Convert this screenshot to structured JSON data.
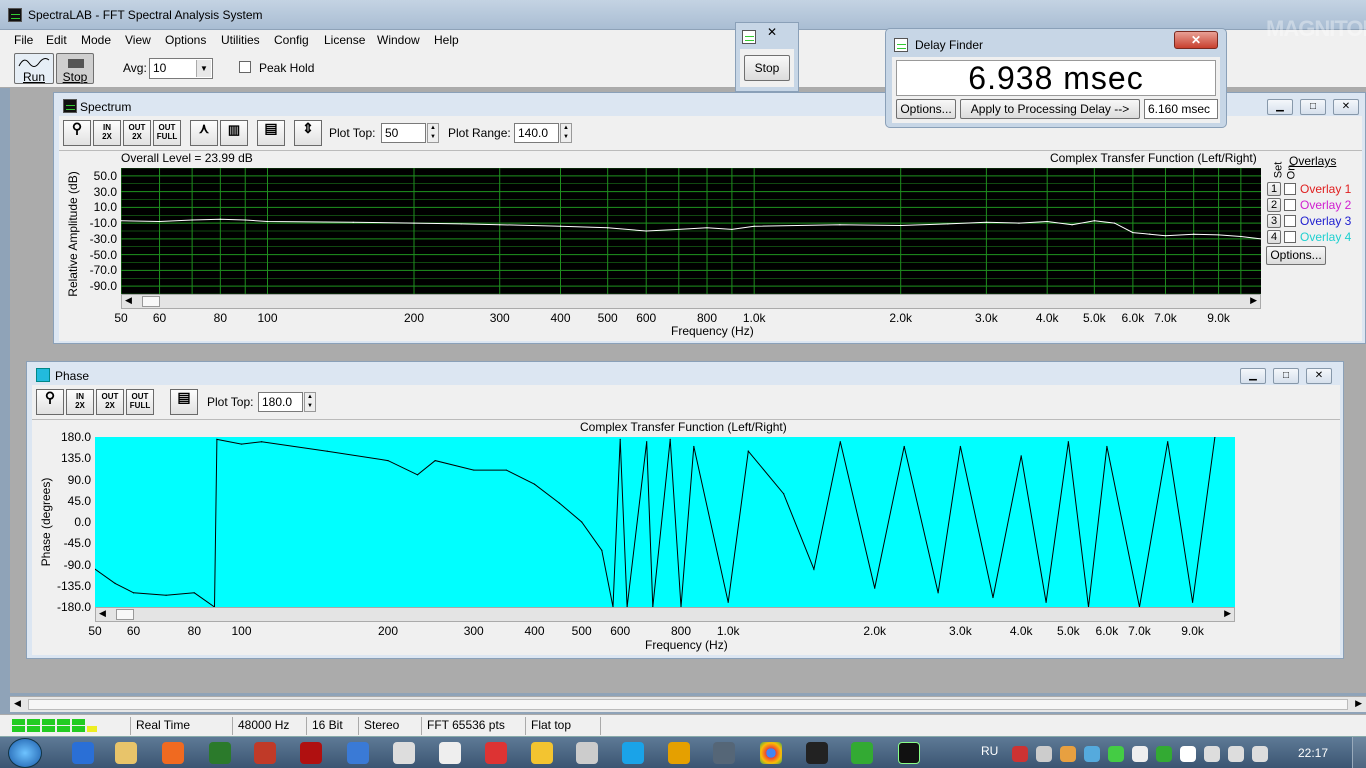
{
  "app": {
    "title": "SpectraLAB - FFT Spectral Analysis System",
    "menu": [
      "File",
      "Edit",
      "Mode",
      "View",
      "Options",
      "Utilities",
      "Config",
      "License",
      "Window",
      "Help"
    ]
  },
  "toolbar": {
    "run_label": "Run",
    "stop_label": "Stop",
    "avg_label": "Avg:",
    "avg_value": "10",
    "peak_hold_label": "Peak Hold"
  },
  "stop_dialog": {
    "stop_label": "Stop"
  },
  "delay_finder": {
    "title": "Delay Finder",
    "readout": "6.938 msec",
    "options_label": "Options...",
    "apply_label": "Apply to Processing Delay -->",
    "delay_value": "6.160 msec"
  },
  "spectrum": {
    "title": "Spectrum",
    "plot_top_label": "Plot Top:",
    "plot_top_value": "50",
    "plot_range_label": "Plot Range:",
    "plot_range_value": "140.0",
    "overall_level": "Overall Level = 23.99 dB",
    "plot_title": "Complex Transfer Function (Left/Right)",
    "overlays_label": "Overlays",
    "set_label": "Set",
    "on_label": "On",
    "overlays": [
      {
        "num": "1",
        "label": "Overlay 1",
        "color": "#e02020"
      },
      {
        "num": "2",
        "label": "Overlay 2",
        "color": "#d020d0"
      },
      {
        "num": "3",
        "label": "Overlay 3",
        "color": "#2020d0"
      },
      {
        "num": "4",
        "label": "Overlay 4",
        "color": "#20d0d0"
      }
    ],
    "overlays_options_label": "Options..."
  },
  "phase": {
    "title": "Phase",
    "plot_top_label": "Plot Top:",
    "plot_top_value": "180.0",
    "plot_title": "Complex Transfer Function (Left/Right)"
  },
  "chart_data": [
    {
      "type": "line",
      "title": "Complex Transfer Function (Left/Right)",
      "xlabel": "Frequency (Hz)",
      "ylabel": "Relative Amplitude (dB)",
      "x_scale": "log",
      "xlim": [
        50,
        11000
      ],
      "ylim": [
        -100,
        60
      ],
      "yticks": [
        "50.0",
        "30.0",
        "10.0",
        "-10.0",
        "-30.0",
        "-50.0",
        "-70.0",
        "-90.0"
      ],
      "ytick_values": [
        50,
        30,
        10,
        -10,
        -30,
        -50,
        -70,
        -90
      ],
      "xticks": [
        "50",
        "60",
        "80",
        "100",
        "200",
        "300",
        "400",
        "500",
        "600",
        "800",
        "1.0k",
        "2.0k",
        "3.0k",
        "4.0k",
        "5.0k",
        "6.0k",
        "7.0k",
        "9.0k"
      ],
      "xtick_values": [
        50,
        60,
        80,
        100,
        200,
        300,
        400,
        500,
        600,
        800,
        1000,
        2000,
        3000,
        4000,
        5000,
        6000,
        7000,
        9000
      ],
      "background": "#000000",
      "grid_color": "#1f8f1f",
      "line_color": "#ffffff",
      "series": [
        {
          "x": [
            50,
            60,
            70,
            80,
            90,
            100,
            150,
            200,
            250,
            300,
            400,
            500,
            600,
            700,
            800,
            900,
            1000,
            1500,
            2000,
            2500,
            3000,
            3500,
            4000,
            4500,
            5000,
            5500,
            6000,
            6500,
            7000,
            8000,
            9000,
            10000,
            11000
          ],
          "y": [
            -7,
            -8,
            -6,
            -5,
            -6,
            -8,
            -9,
            -10,
            -11,
            -12,
            -14,
            -16,
            -20,
            -18,
            -16,
            -18,
            -14,
            -12,
            -13,
            -11,
            -9,
            -10,
            -8,
            -12,
            -7,
            -10,
            -22,
            -24,
            -26,
            -24,
            -25,
            -27,
            -30
          ]
        }
      ]
    },
    {
      "type": "line",
      "title": "Complex Transfer Function (Left/Right)",
      "xlabel": "Frequency (Hz)",
      "ylabel": "Phase (degrees)",
      "x_scale": "log",
      "xlim": [
        50,
        11000
      ],
      "ylim": [
        -180,
        180
      ],
      "yticks": [
        "180.0",
        "135.0",
        "90.0",
        "45.0",
        "0.0",
        "-45.0",
        "-90.0",
        "-135.0",
        "-180.0"
      ],
      "ytick_values": [
        180,
        135,
        90,
        45,
        0,
        -45,
        -90,
        -135,
        -180
      ],
      "xticks": [
        "50",
        "60",
        "80",
        "100",
        "200",
        "300",
        "400",
        "500",
        "600",
        "800",
        "1.0k",
        "2.0k",
        "3.0k",
        "4.0k",
        "5.0k",
        "6.0k",
        "7.0k",
        "9.0k"
      ],
      "xtick_values": [
        50,
        60,
        80,
        100,
        200,
        300,
        400,
        500,
        600,
        800,
        1000,
        2000,
        3000,
        4000,
        5000,
        6000,
        7000,
        9000
      ],
      "background": "#00ffff",
      "line_color": "#000000",
      "series": [
        {
          "x": [
            50,
            55,
            60,
            70,
            80,
            88,
            89,
            100,
            110,
            150,
            200,
            230,
            250,
            300,
            350,
            400,
            450,
            500,
            550,
            580,
            600,
            620,
            680,
            700,
            760,
            800,
            850,
            1000,
            1100,
            1300,
            1500,
            1700,
            2000,
            2300,
            2700,
            3000,
            3500,
            4000,
            4500,
            5000,
            5500,
            6000,
            7000,
            8000,
            9000,
            10000
          ],
          "y": [
            -100,
            -130,
            -150,
            -155,
            -150,
            -180,
            175,
            165,
            170,
            150,
            130,
            100,
            130,
            110,
            110,
            80,
            40,
            0,
            -60,
            -180,
            175,
            -180,
            170,
            -180,
            175,
            -180,
            160,
            -170,
            150,
            60,
            -100,
            170,
            -140,
            160,
            -150,
            160,
            -160,
            140,
            -170,
            170,
            -180,
            160,
            -180,
            170,
            -170,
            180
          ]
        }
      ]
    }
  ],
  "status": {
    "mode": "Real Time",
    "rate": "48000 Hz",
    "bits": "16 Bit",
    "channels": "Stereo",
    "fft": "FFT 65536 pts",
    "window": "Flat top"
  },
  "taskbar": {
    "lang": "RU",
    "time": "22:17"
  },
  "watermark": "MAGNITOLA"
}
